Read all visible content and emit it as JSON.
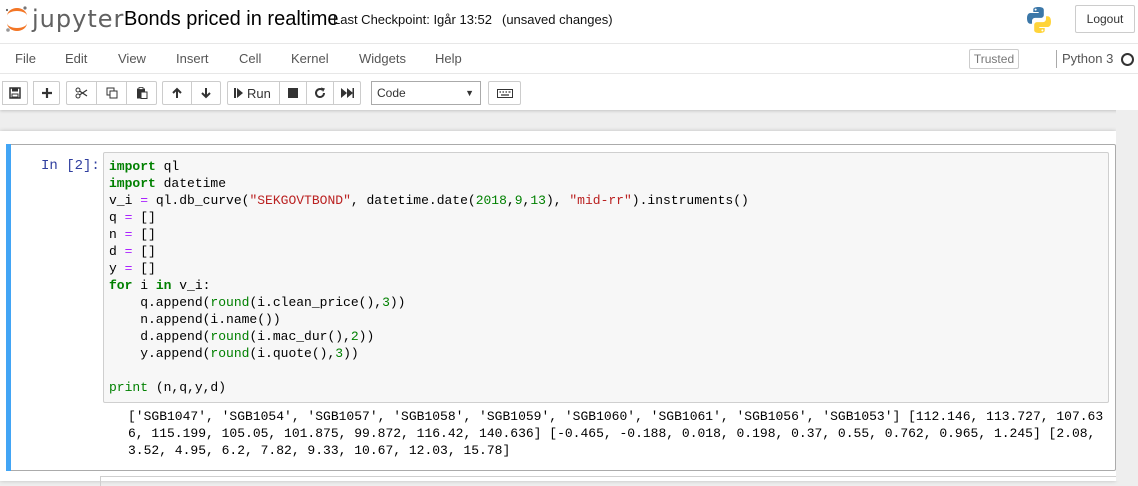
{
  "header": {
    "logo_text": "jupyter",
    "notebook_name": "Bonds priced in realtime",
    "checkpoint": "Last Checkpoint: Igår 13:52",
    "autosave": "(unsaved changes)",
    "logout_label": "Logout"
  },
  "menu": {
    "items": [
      "File",
      "Edit",
      "View",
      "Insert",
      "Cell",
      "Kernel",
      "Widgets",
      "Help"
    ],
    "trusted": "Trusted",
    "kernel_name": "Python 3"
  },
  "toolbar": {
    "run_label": "Run",
    "cell_type": "Code",
    "icons": [
      "save-icon",
      "plus-icon",
      "cut-icon",
      "copy-icon",
      "paste-icon",
      "arrow-up-icon",
      "arrow-down-icon",
      "step-forward-icon",
      "stop-icon",
      "refresh-icon",
      "fast-forward-icon",
      "keyboard-icon"
    ]
  },
  "cell": {
    "prompt": "In [2]:",
    "code": [
      "import ql",
      "import datetime",
      "v_i = ql.db_curve(\"SEKGOVTBOND\", datetime.date(2018,9,13), \"mid-rr\").instruments()",
      "q = []",
      "n = []",
      "d = []",
      "y = []",
      "for i in v_i:",
      "    q.append(round(i.clean_price(),3))",
      "    n.append(i.name())",
      "    d.append(round(i.mac_dur(),2))",
      "    y.append(round(i.quote(),3))",
      "",
      "print (n,q,y,d)"
    ],
    "output": [
      "['SGB1047', 'SGB1054', 'SGB1057', 'SGB1058', 'SGB1059', 'SGB1060', 'SGB1061', 'SGB1056', 'SGB1053'] [112.146, 113.727, 107.63",
      "6, 115.199, 105.05, 101.875, 99.872, 116.42, 140.636] [-0.465, -0.188, 0.018, 0.198, 0.37, 0.55, 0.762, 0.965, 1.245] [2.08,",
      "3.52, 4.95, 6.2, 7.82, 9.33, 10.67, 12.03, 15.78]"
    ]
  },
  "colors": {
    "accent": "#42a5f5",
    "prompt": "#303f9f",
    "keyword": "#008000",
    "string": "#ba2121",
    "operator": "#aa22ff"
  }
}
